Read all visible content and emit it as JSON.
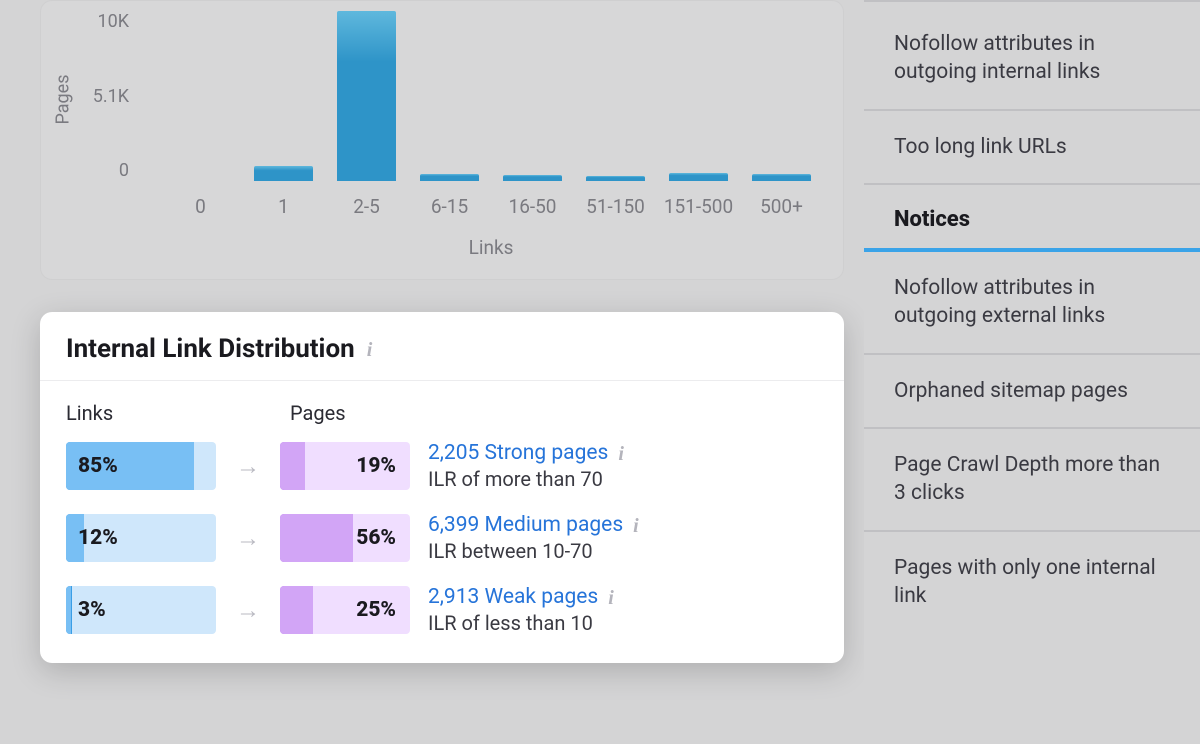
{
  "chart_data": {
    "type": "bar",
    "title": "",
    "xlabel": "Links",
    "ylabel": "Pages",
    "categories": [
      "0",
      "1",
      "2-5",
      "6-15",
      "16-50",
      "51-150",
      "151-500",
      "500+"
    ],
    "values": [
      0,
      900,
      10000,
      400,
      350,
      300,
      500,
      400
    ],
    "ylim": [
      0,
      10000
    ],
    "yticks": [
      "10K",
      "5.1K",
      "0"
    ]
  },
  "distribution": {
    "title": "Internal Link Distribution",
    "columns": {
      "links": "Links",
      "pages": "Pages"
    },
    "rows": [
      {
        "links_pct": "85%",
        "links_fill": 85,
        "pages_pct": "19%",
        "pages_fill": 19,
        "link_text": "2,205 Strong pages",
        "sub_text": "ILR of more than 70"
      },
      {
        "links_pct": "12%",
        "links_fill": 12,
        "pages_pct": "56%",
        "pages_fill": 56,
        "link_text": "6,399 Medium pages",
        "sub_text": "ILR between 10-70"
      },
      {
        "links_pct": "3%",
        "links_fill": 3,
        "pages_pct": "25%",
        "pages_fill": 25,
        "link_text": "2,913 Weak pages",
        "sub_text": "ILR of less than 10"
      }
    ]
  },
  "sidebar": {
    "items_top": [
      "Nofollow attributes in outgoing internal links",
      "Too long link URLs"
    ],
    "heading": "Notices",
    "items_bottom": [
      "Nofollow attributes in outgoing external links",
      "Orphaned sitemap pages",
      "Page Crawl Depth more than 3 clicks",
      "Pages with only one internal link"
    ]
  }
}
